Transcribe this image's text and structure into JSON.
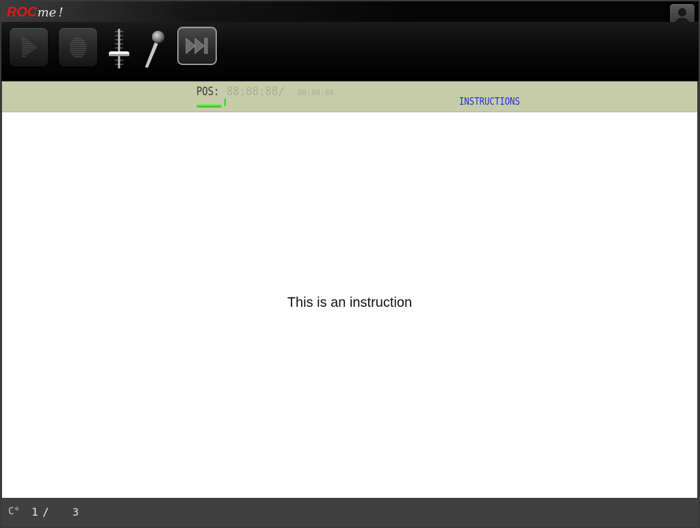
{
  "app": {
    "logo_roc": "ROC",
    "logo_me": "me",
    "logo_bang": "!"
  },
  "toolbar": {
    "play_icon": "play-icon",
    "record_icon": "record-icon",
    "slider_icon": "volume-slider-icon",
    "mic_icon": "microphone-icon",
    "skip_icon": "skip-forward-icon",
    "user_icon": "user-icon"
  },
  "status": {
    "pos_label": "POS:",
    "pos_time": "88:88:88/",
    "total_time": "88:88:88",
    "progress": 0.78,
    "instructions_link": "INSTRUCTIONS"
  },
  "content": {
    "instruction": "This is an instruction"
  },
  "footer": {
    "icon": "C°",
    "page_current": "1",
    "page_sep": "/",
    "page_total": "3"
  },
  "colors": {
    "logo_red": "#e01818",
    "status_bg": "#c6cca9",
    "link_blue": "#2030e6",
    "progress_green": "#3dcc25"
  }
}
